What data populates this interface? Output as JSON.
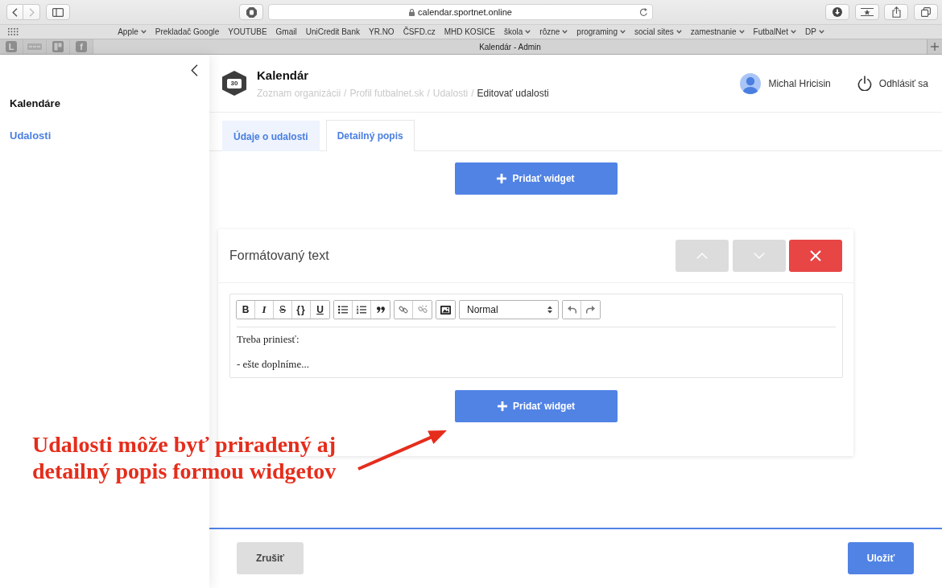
{
  "browser": {
    "url": "calendar.sportnet.online",
    "bookmarks": [
      {
        "label": "Apple",
        "folder": true
      },
      {
        "label": "Prekladač Google",
        "folder": false
      },
      {
        "label": "YOUTUBE",
        "folder": false
      },
      {
        "label": "Gmail",
        "folder": false
      },
      {
        "label": "UniCredit Bank",
        "folder": false
      },
      {
        "label": "YR.NO",
        "folder": false
      },
      {
        "label": "ČSFD.cz",
        "folder": false
      },
      {
        "label": "MHD KOSICE",
        "folder": false
      },
      {
        "label": "škola",
        "folder": true
      },
      {
        "label": "rôzne",
        "folder": true
      },
      {
        "label": "programing",
        "folder": true
      },
      {
        "label": "social sites",
        "folder": true
      },
      {
        "label": "zamestnanie",
        "folder": true
      },
      {
        "label": "FutbalNet",
        "folder": true
      },
      {
        "label": "DP",
        "folder": true
      }
    ],
    "pinned_tabs": [
      {
        "kind": "letter",
        "glyph": "L"
      },
      {
        "kind": "strip"
      },
      {
        "kind": "board"
      },
      {
        "kind": "letter",
        "glyph": "f"
      }
    ],
    "tab_title": "Kalendár - Admin"
  },
  "sidebar": {
    "items": [
      {
        "label": "Kalendáre",
        "selected": false
      },
      {
        "label": "Udalosti",
        "selected": true
      }
    ]
  },
  "header": {
    "logo_text": "30",
    "title": "Kalendár",
    "breadcrumbs": [
      {
        "label": "Zoznam organizácii",
        "current": false,
        "separator": "/"
      },
      {
        "label": "Profil futbalnet.sk",
        "current": false,
        "separator": "/"
      },
      {
        "label": "Udalosti",
        "current": false,
        "separator": "/"
      },
      {
        "label": "Editovať udalosti",
        "current": true
      }
    ],
    "user_name": "Michal Hricisin",
    "logout_label": "Odhlásiť sa"
  },
  "tabs": [
    {
      "label": "Údaje o udalosti",
      "selected": false
    },
    {
      "label": "Detailný popis",
      "selected": true
    }
  ],
  "content": {
    "add_widget_label": "Pridať widget",
    "widgets": [
      {
        "kind": "formatted-text",
        "title": "Formátovaný text",
        "toolbar": [
          {
            "kind": "group",
            "buttons": [
              {
                "kind": "bold",
                "glyph": "B"
              },
              {
                "kind": "italic",
                "glyph": "I"
              },
              {
                "kind": "strikethrough",
                "glyph": "S"
              },
              {
                "kind": "code",
                "glyph": "{}"
              },
              {
                "kind": "underline",
                "glyph": "U"
              }
            ]
          },
          {
            "kind": "group",
            "buttons": [
              {
                "kind": "bullet-list"
              },
              {
                "kind": "numbered-list"
              },
              {
                "kind": "quote"
              }
            ]
          },
          {
            "kind": "group",
            "buttons": [
              {
                "kind": "link"
              },
              {
                "kind": "unlink"
              }
            ]
          },
          {
            "kind": "group",
            "buttons": [
              {
                "kind": "image"
              }
            ]
          },
          {
            "kind": "select",
            "value": "Normal"
          },
          {
            "kind": "group",
            "buttons": [
              {
                "kind": "undo"
              },
              {
                "kind": "redo"
              }
            ]
          }
        ],
        "paragraphs": [
          "Treba priniesť:",
          "- ešte doplníme..."
        ],
        "add_widget_label": "Pridať widget"
      }
    ]
  },
  "footer": {
    "cancel_label": "Zrušiť",
    "save_label": "Uložiť"
  },
  "annotation": {
    "lines": [
      "Udalosti môže byť priradený aj",
      "detailný popis formou widgetov"
    ]
  }
}
